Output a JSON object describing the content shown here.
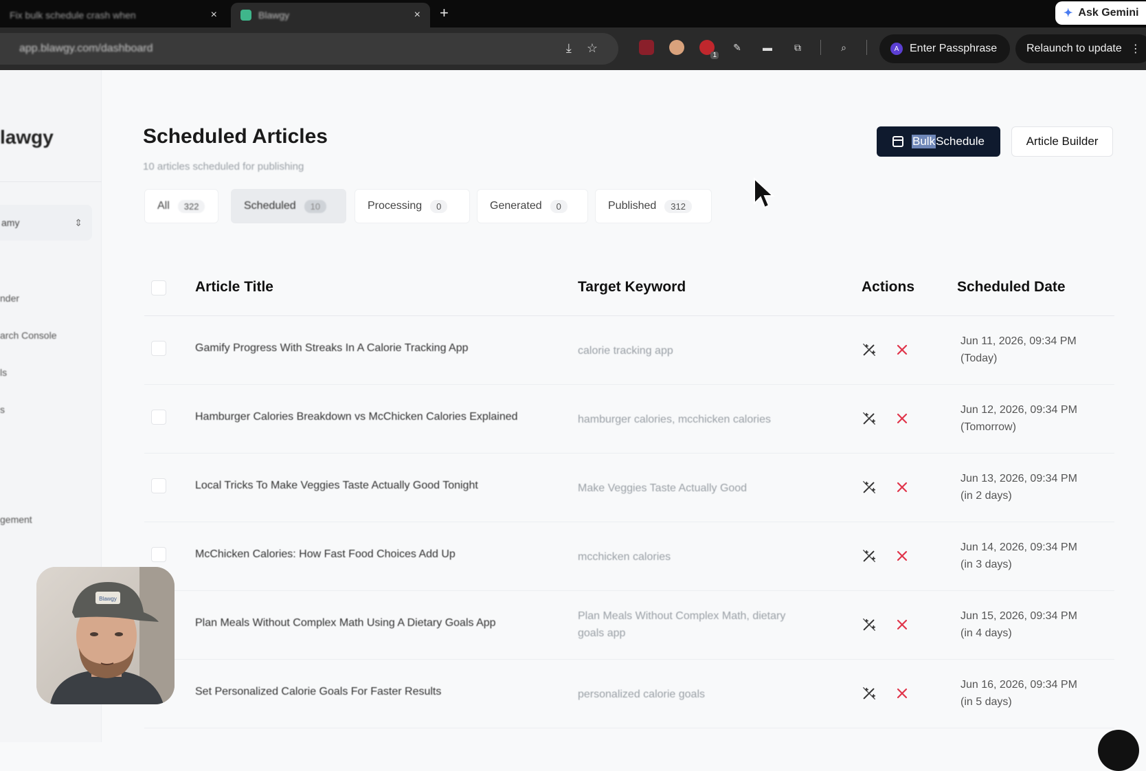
{
  "browser": {
    "tabs": [
      {
        "title": "Fix bulk schedule crash when",
        "active": false
      },
      {
        "title": "Blawgy",
        "active": true
      }
    ],
    "new_tab_label": "+",
    "close_glyph": "×",
    "ask_gemini": "Ask Gemini",
    "url": "app.blawgy.com/dashboard",
    "passphrase_label": "Enter Passphrase",
    "passphrase_avatar": "A",
    "relaunch_label": "Relaunch to update",
    "ext_badge": "1",
    "colors": {
      "tabstrip": "#0b0b0b",
      "toolbar": "#2a2a2a",
      "favicon": "#3fb68b"
    }
  },
  "sidebar": {
    "brand": "lawgy",
    "workspace": "amy",
    "items": [
      {
        "label": "nder"
      },
      {
        "label": "arch Console"
      },
      {
        "label": "ls"
      },
      {
        "label": "s"
      },
      {
        "label": "gement"
      }
    ]
  },
  "header": {
    "title": "Scheduled Articles",
    "subtitle": "10 articles scheduled for publishing",
    "bulk_highlight": "Bulk",
    "bulk_rest": " Schedule",
    "article_builder": "Article Builder",
    "colors": {
      "primary": "#0f1a2e",
      "delete": "#e0344a"
    }
  },
  "filters": [
    {
      "label": "All",
      "count": "322",
      "active": false
    },
    {
      "label": "Scheduled",
      "count": "10",
      "active": true
    },
    {
      "label": "Processing",
      "count": "0",
      "active": false
    },
    {
      "label": "Generated",
      "count": "0",
      "active": false
    },
    {
      "label": "Published",
      "count": "312",
      "active": false
    }
  ],
  "table": {
    "columns": {
      "title": "Article Title",
      "keyword": "Target Keyword",
      "actions": "Actions",
      "date": "Scheduled Date"
    },
    "rows": [
      {
        "title": "Gamify Progress With Streaks In A Calorie Tracking App",
        "keyword": "calorie tracking app",
        "date": "Jun 11, 2026, 09:34 PM",
        "relative": "(Today)"
      },
      {
        "title": "Hamburger Calories Breakdown vs McChicken Calories Explained",
        "keyword": "hamburger calories, mcchicken calories",
        "date": "Jun 12, 2026, 09:34 PM",
        "relative": "(Tomorrow)"
      },
      {
        "title": "Local Tricks To Make Veggies Taste Actually Good Tonight",
        "keyword": "Make Veggies Taste Actually Good",
        "date": "Jun 13, 2026, 09:34 PM",
        "relative": "(in 2 days)"
      },
      {
        "title": "McChicken Calories: How Fast Food Choices Add Up",
        "keyword": "mcchicken calories",
        "date": "Jun 14, 2026, 09:34 PM",
        "relative": "(in 3 days)"
      },
      {
        "title": "Plan Meals Without Complex Math Using A Dietary Goals App",
        "keyword": "Plan Meals Without Complex Math, dietary goals app",
        "date": "Jun 15, 2026, 09:34 PM",
        "relative": "(in 4 days)"
      },
      {
        "title": "Set Personalized Calorie Goals For Faster Results",
        "keyword": "personalized calorie goals",
        "date": "Jun 16, 2026, 09:34 PM",
        "relative": "(in 5 days)"
      }
    ]
  },
  "webcam": {
    "cap_text": "Blawgy"
  }
}
